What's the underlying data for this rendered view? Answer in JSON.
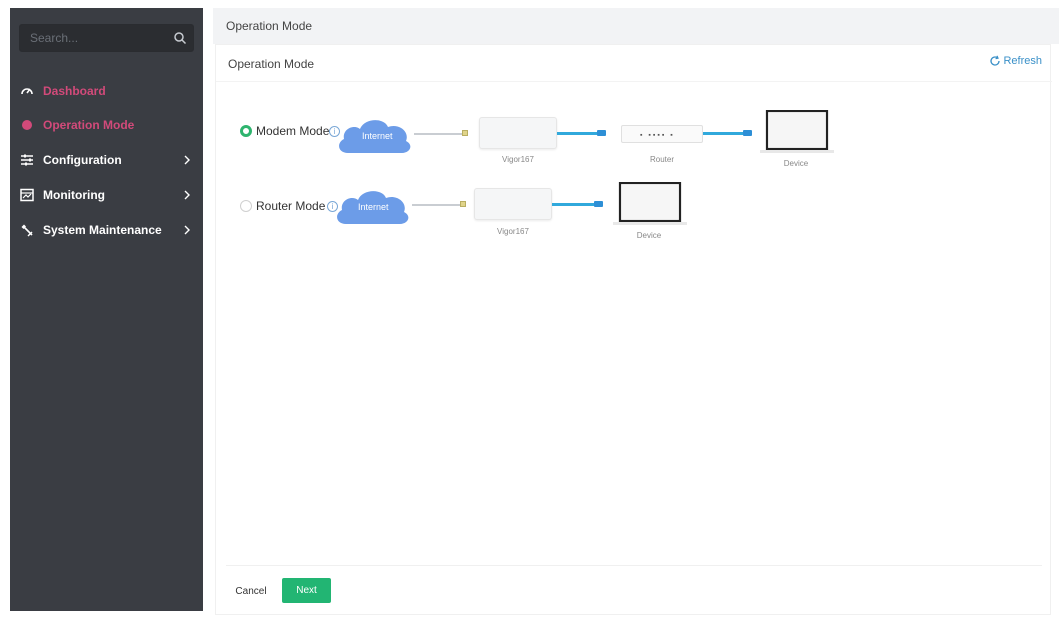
{
  "sidebar": {
    "search_placeholder": "Search...",
    "items": [
      {
        "label": "Dashboard",
        "icon": "dashboard-icon"
      },
      {
        "label": "Operation Mode",
        "icon": "dot-icon"
      },
      {
        "label": "Configuration",
        "icon": "configuration-icon"
      },
      {
        "label": "Monitoring",
        "icon": "monitoring-icon"
      },
      {
        "label": "System Maintenance",
        "icon": "wrench-icon"
      }
    ]
  },
  "header": {
    "breadcrumb": "Operation Mode"
  },
  "panel": {
    "title": "Operation Mode",
    "refresh_label": "Refresh"
  },
  "modes": [
    {
      "label": "Modem Mode",
      "selected": true,
      "cloud_label": "Internet",
      "captions": [
        "Vigor167",
        "Router",
        "Device"
      ]
    },
    {
      "label": "Router Mode",
      "selected": false,
      "cloud_label": "Internet",
      "captions": [
        "Vigor167",
        "Device"
      ]
    }
  ],
  "footer": {
    "cancel_label": "Cancel",
    "next_label": "Next"
  },
  "colors": {
    "accent_green": "#22b573",
    "link_blue": "#3a90c8",
    "sidebar_bg": "#3a3d43",
    "sidebar_active": "#d24a7a",
    "cable_blue": "#31a9dc"
  }
}
